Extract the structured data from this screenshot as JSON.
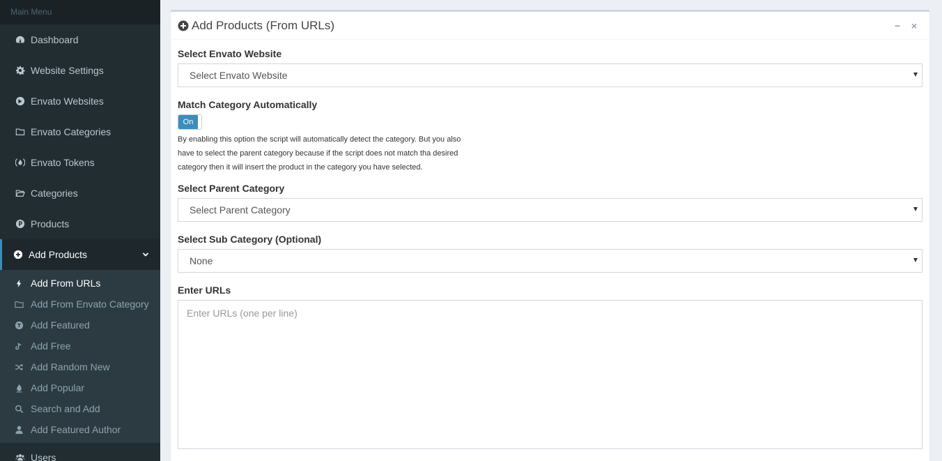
{
  "sidebar": {
    "header": "Main Menu",
    "items": [
      {
        "label": "Dashboard",
        "icon": "dashboard-icon"
      },
      {
        "label": "Website Settings",
        "icon": "gear-icon"
      },
      {
        "label": "Envato Websites",
        "icon": "globe-icon"
      },
      {
        "label": "Envato Categories",
        "icon": "folder-icon"
      },
      {
        "label": "Envato Tokens",
        "icon": "fire-badge-icon"
      },
      {
        "label": "Categories",
        "icon": "folder-open-icon"
      },
      {
        "label": "Products",
        "icon": "product-p-icon"
      },
      {
        "label": "Add Products",
        "icon": "plus-circle-icon"
      }
    ],
    "sub_items": [
      {
        "label": "Add From URLs",
        "icon": "bolt-icon"
      },
      {
        "label": "Add From Envato Category",
        "icon": "folder-icon"
      },
      {
        "label": "Add Featured",
        "icon": "featured-badge-icon"
      },
      {
        "label": "Add Free",
        "icon": "tiktok-style-icon"
      },
      {
        "label": "Add Random New",
        "icon": "shuffle-icon"
      },
      {
        "label": "Add Popular",
        "icon": "fire-icon"
      },
      {
        "label": "Search and Add",
        "icon": "search-icon"
      },
      {
        "label": "Add Featured Author",
        "icon": "user-icon"
      }
    ],
    "users_label": "Users"
  },
  "box": {
    "title": "Add Products (From URLs)",
    "minimize": "−",
    "close": "×"
  },
  "form": {
    "website_label": "Select Envato Website",
    "website_value": "Select Envato Website",
    "match_label": "Match Category Automatically",
    "toggle_on": "On",
    "help_text": "By enabling this option the script will automatically detect the category. But you also have to select the parent category because if the script does not match tha desired category then it will insert the product in the category you have selected.",
    "parent_label": "Select Parent Category",
    "parent_value": "Select Parent Category",
    "sub_label": "Select Sub Category (Optional)",
    "sub_value": "None",
    "urls_label": "Enter URLs",
    "urls_placeholder": "Enter URLs (one per line)"
  },
  "colors": {
    "sidebar_bg": "#222d32",
    "accent": "#3c8dbc"
  }
}
